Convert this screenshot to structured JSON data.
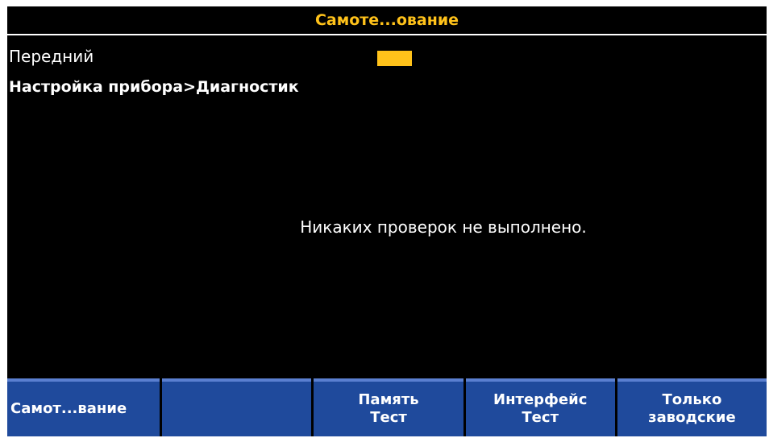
{
  "title": "Самоте...ование",
  "source_label": "Передний",
  "indicator_color": "#ffc21a",
  "breadcrumb": "Настройка прибора>Диагностик",
  "message": "Никаких проверок не выполнено.",
  "softkeys": [
    {
      "line1": "Самот...вание",
      "line2": ""
    },
    {
      "line1": "",
      "line2": ""
    },
    {
      "line1": "Память",
      "line2": "Тест"
    },
    {
      "line1": "Интерфейс",
      "line2": "Тест"
    },
    {
      "line1": "Только",
      "line2": "заводские"
    }
  ],
  "colors": {
    "background": "#000000",
    "title_text": "#ffc21a",
    "softkey_bg": "#1f4a9c",
    "text": "#ffffff"
  }
}
